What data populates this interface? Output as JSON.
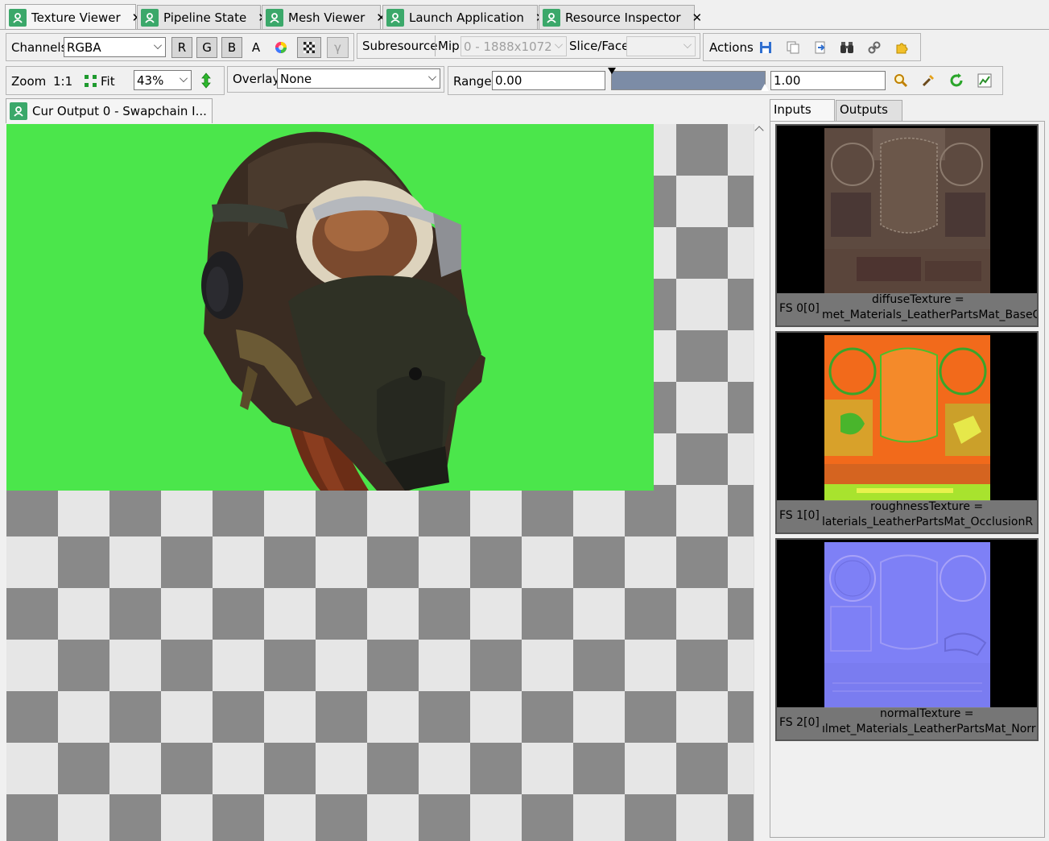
{
  "tabs": [
    {
      "label": "Texture Viewer",
      "active": true
    },
    {
      "label": "Pipeline State",
      "active": false
    },
    {
      "label": "Mesh Viewer",
      "active": false
    },
    {
      "label": "Launch Application",
      "active": false
    },
    {
      "label": "Resource Inspector",
      "active": false
    }
  ],
  "toolbar": {
    "channels_label": "Channels",
    "channels_value": "RGBA",
    "r": "R",
    "g": "G",
    "b": "B",
    "a": "A",
    "gamma": "γ",
    "subresource_label": "Subresource",
    "mip_label": "Mip",
    "mip_value": "0 - 1888x1072",
    "slice_label": "Slice/Face",
    "slice_value": "",
    "actions_label": "Actions",
    "zoom_label": "Zoom",
    "zoom_1to1": "1:1",
    "fit_label": "Fit",
    "zoom_value": "43%",
    "overlay_label": "Overlay",
    "overlay_value": "None",
    "range_label": "Range",
    "range_min": "0.00",
    "range_max": "1.00"
  },
  "viewer": {
    "tab_label": "Cur Output 0 - Swapchain I...",
    "background_color": "#4be64b"
  },
  "panel": {
    "tab_inputs": "Inputs",
    "tab_outputs": "Outputs",
    "thumbs": [
      {
        "slot": "FS 0[0]",
        "name": "diffuseTexture =",
        "resource": "met_Materials_LeatherPartsMat_BaseC"
      },
      {
        "slot": "FS 1[0]",
        "name": "roughnessTexture =",
        "resource": "laterials_LeatherPartsMat_OcclusionR"
      },
      {
        "slot": "FS 2[0]",
        "name": "normalTexture =",
        "resource": "ılmet_Materials_LeatherPartsMat_Norr"
      }
    ]
  },
  "colors": {
    "tab_icon": "#3ba86a",
    "range_bar": "#7c8ca6",
    "checker_dark": "#898989",
    "checker_light": "#e6e6e6"
  }
}
